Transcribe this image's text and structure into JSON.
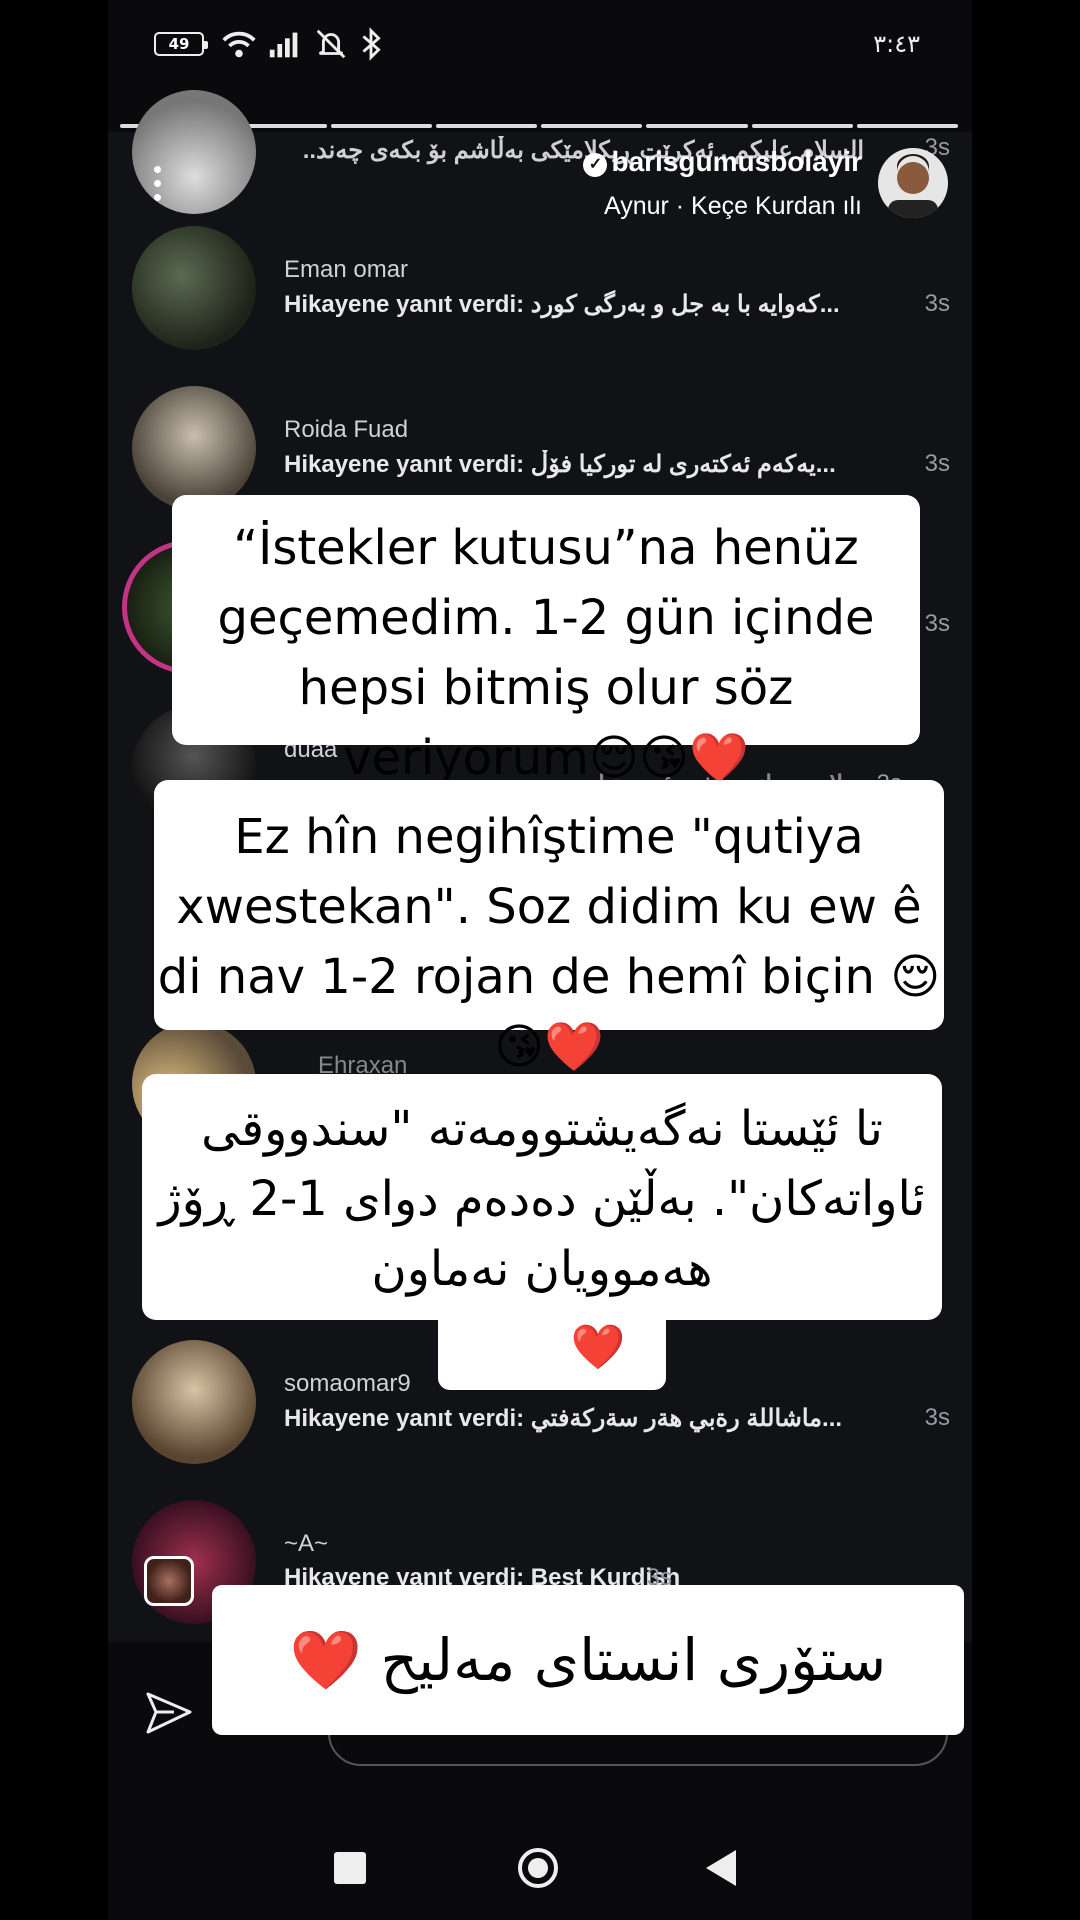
{
  "status_bar": {
    "battery": "49",
    "clock": "٣:٤٣"
  },
  "story": {
    "username": "barisgumusbolayir",
    "music_artist": "Aynur",
    "music_sep": " · ",
    "music_title": "Keçe Kurdan",
    "replies": [
      {
        "name": "",
        "msg": "السلام عليكم , ئەكرێت ڕيكلامێكى بەڵاشم بۆ بكەى چەند..",
        "time": "3s"
      },
      {
        "name": "Eman omar",
        "msg": "Hikayene yanıt verdi: کەوایە با بە جل و بەرگی کورد...",
        "time": "3s"
      },
      {
        "name": "Roida Fuad",
        "msg": "Hikayene yanıt verdi: یەکەم ئەکتەری لە تورکیا فۆڵ...",
        "time": "3s"
      },
      {
        "name": "duaa",
        "msg": "سلاو چەوانی باشی ئەم دنیا ...",
        "time": "3s"
      },
      {
        "name": "Ehraxan",
        "msg": "",
        "time": ""
      },
      {
        "name": "somaomar9",
        "msg": "Hikayene yanıt verdi: ماشاللة رةبي هةر سةركةفتي...",
        "time": "3s"
      },
      {
        "name": "~A~",
        "msg": "Hikayene yanıt verdi: Best Kurdish",
        "time": "3s"
      }
    ]
  },
  "overlays": {
    "turkish": "“İstekler kutusu”na henüz geçemedim. 1-2 gün içinde hepsi bitmiş olur söz veriyorum",
    "kurmanji": "Ez hîn negihîştime \"qutiya xwestekan\". Soz didim ku ew ê di nav 1-2 rojan de hemî biçin",
    "sorani": "تا ئێستا نەگەیشتوومەتە \"سندووقی ئاواتەکان\". بەڵێن دەدەم دوای 1-2 ڕۆژ هەموویان نەماون",
    "emoji": "😌😘❤️",
    "caption": "ستۆری انستای مەلیح",
    "caption_heart": "❤️"
  },
  "icons": [
    "battery-icon",
    "wifi-icon",
    "signal-icon",
    "bell-off-icon",
    "bluetooth-icon",
    "verified-badge-icon",
    "music-bars-icon",
    "more-dots-icon",
    "send-icon",
    "nav-recents-icon",
    "nav-home-icon",
    "nav-back-icon"
  ]
}
